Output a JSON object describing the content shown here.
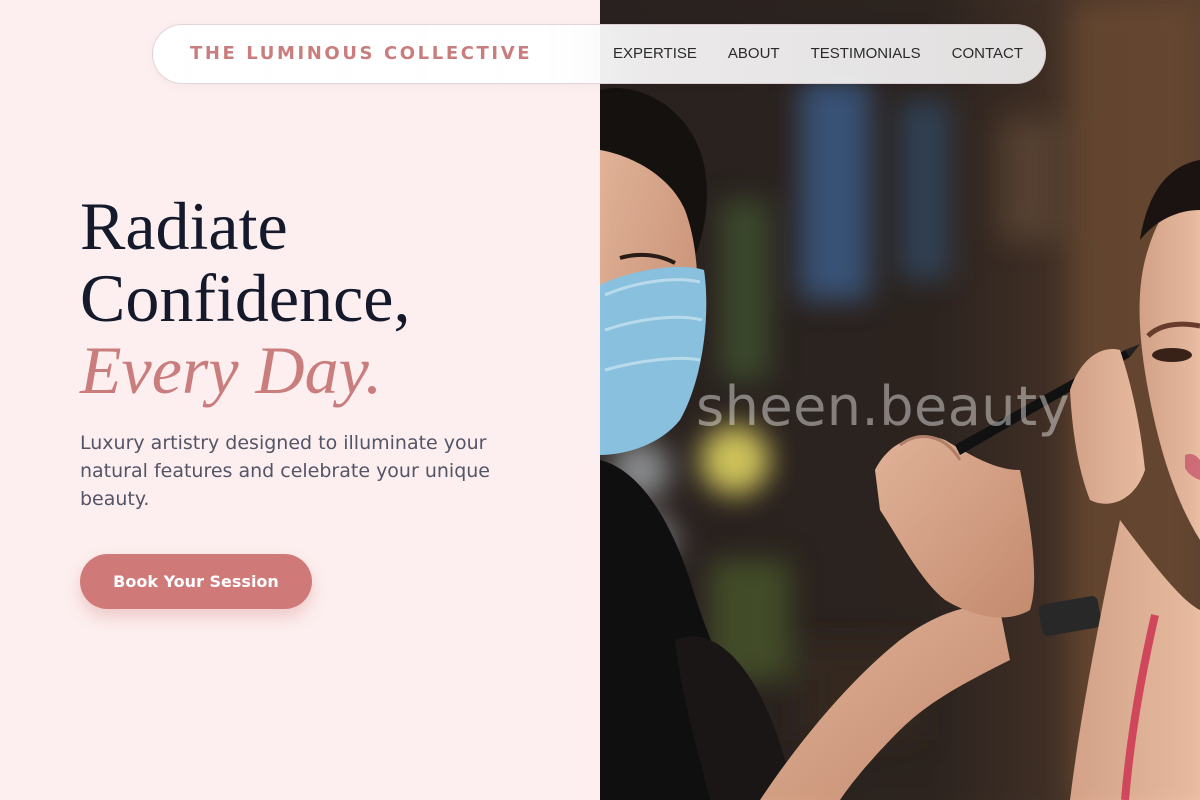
{
  "nav": {
    "brand": "THE LUMINOUS COLLECTIVE",
    "links": [
      "EXPERTISE",
      "ABOUT",
      "TESTIMONIALS",
      "CONTACT"
    ]
  },
  "hero": {
    "title_line1": "Radiate",
    "title_line2": "Confidence,",
    "title_accent": "Every Day.",
    "description": "Luxury artistry designed to illuminate your natural features and celebrate your unique beauty.",
    "cta_label": "Book Your Session"
  },
  "photo": {
    "watermark": "sheen.beauty"
  },
  "colors": {
    "background": "#fdefef",
    "accent": "#c97d7d",
    "button": "#d07979",
    "heading": "#141a2c",
    "body_text": "#535466"
  }
}
